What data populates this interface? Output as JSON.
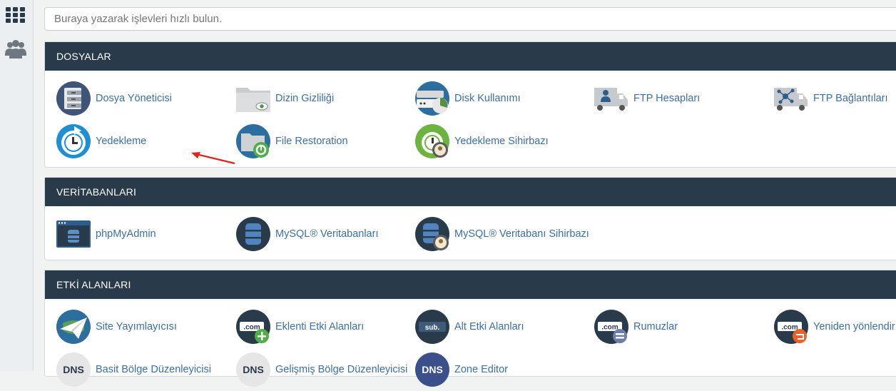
{
  "search": {
    "placeholder": "Buraya yazarak işlevleri hızlı bulun."
  },
  "sidebar": {
    "items": [
      {
        "icon": "apps-grid-icon"
      },
      {
        "icon": "users-icon"
      }
    ]
  },
  "colors": {
    "panel_header": "#293a4a",
    "link": "#3b6fa6",
    "annotation_arrow": "#e0241c"
  },
  "sections": {
    "files": {
      "title": "DOSYALAR",
      "items": [
        {
          "label": "Dosya Yöneticisi",
          "icon": "file-manager-icon"
        },
        {
          "label": "Dizin Gizliliği",
          "icon": "directory-privacy-icon"
        },
        {
          "label": "Disk Kullanımı",
          "icon": "disk-usage-icon"
        },
        {
          "label": "FTP Hesapları",
          "icon": "ftp-accounts-icon"
        },
        {
          "label": "FTP Bağlantıları",
          "icon": "ftp-connections-icon"
        },
        {
          "label": "Yedekleme",
          "icon": "backup-icon"
        },
        {
          "label": "File Restoration",
          "icon": "file-restoration-icon"
        },
        {
          "label": "Yedekleme Sihirbazı",
          "icon": "backup-wizard-icon"
        }
      ]
    },
    "databases": {
      "title": "VERİTABANLARI",
      "items": [
        {
          "label": "phpMyAdmin",
          "icon": "phpmyadmin-icon"
        },
        {
          "label": "MySQL® Veritabanları",
          "icon": "mysql-databases-icon"
        },
        {
          "label": "MySQL® Veritabanı Sihirbazı",
          "icon": "mysql-wizard-icon"
        }
      ]
    },
    "domains": {
      "title": "ETKİ ALANLARI",
      "items": [
        {
          "label": "Site Yayımlayıcısı",
          "icon": "site-publisher-icon"
        },
        {
          "label": "Eklenti Etki Alanları",
          "icon": "addon-domains-icon",
          "badge": ".com"
        },
        {
          "label": "Alt Etki Alanları",
          "icon": "subdomains-icon",
          "badge": "sub."
        },
        {
          "label": "Rumuzlar",
          "icon": "aliases-icon",
          "badge": ".com"
        },
        {
          "label": "Yeniden yönlendir",
          "icon": "redirects-icon",
          "badge": ".com"
        },
        {
          "label": "Basit Bölge Düzenleyicisi",
          "icon": "simple-zone-editor-icon",
          "badge": "DNS"
        },
        {
          "label": "Gelişmiş Bölge Düzenleyicisi",
          "icon": "advanced-zone-editor-icon",
          "badge": "DNS"
        },
        {
          "label": "Zone Editor",
          "icon": "zone-editor-icon",
          "badge": "DNS"
        }
      ]
    }
  }
}
